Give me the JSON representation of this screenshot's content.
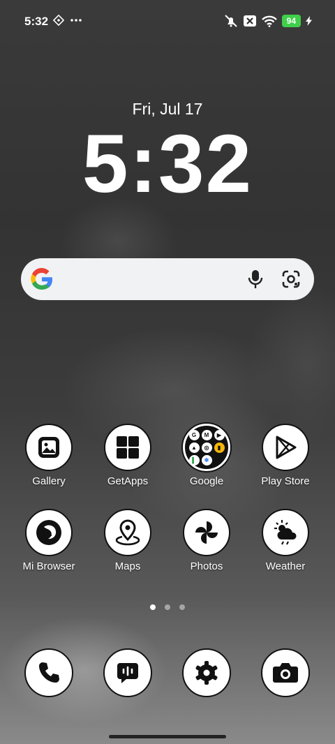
{
  "status_bar": {
    "time": "5:32",
    "battery": "94",
    "icons": [
      "nfc-icon",
      "more-dots-icon",
      "mute-icon",
      "no-sim-icon",
      "wifi-icon",
      "charging-icon"
    ],
    "battery_color": "#3fcf4a"
  },
  "lockscreen_widget": {
    "date": "Fri, Jul 17",
    "clock": "5:32"
  },
  "search_widget": {
    "icons": [
      "google-g-icon",
      "mic-icon",
      "google-lens-icon"
    ]
  },
  "apps": [
    {
      "label": "Gallery",
      "icon": "gallery-icon"
    },
    {
      "label": "GetApps",
      "icon": "getapps-icon"
    },
    {
      "label": "Google",
      "icon": "google-folder-icon"
    },
    {
      "label": "Play Store",
      "icon": "play-store-icon"
    },
    {
      "label": "Mi Browser",
      "icon": "mi-browser-icon"
    },
    {
      "label": "Maps",
      "icon": "maps-icon"
    },
    {
      "label": "Photos",
      "icon": "photos-icon"
    },
    {
      "label": "Weather",
      "icon": "weather-icon"
    }
  ],
  "google_folder": {
    "items": [
      "G",
      "M",
      "▶",
      "▲",
      "◎",
      "▮",
      "▌",
      "✱",
      "○"
    ]
  },
  "page_indicator": {
    "count": 3,
    "active_index": 0
  },
  "dock": [
    {
      "icon": "phone-icon"
    },
    {
      "icon": "messages-icon"
    },
    {
      "icon": "settings-icon"
    },
    {
      "icon": "camera-icon"
    }
  ]
}
